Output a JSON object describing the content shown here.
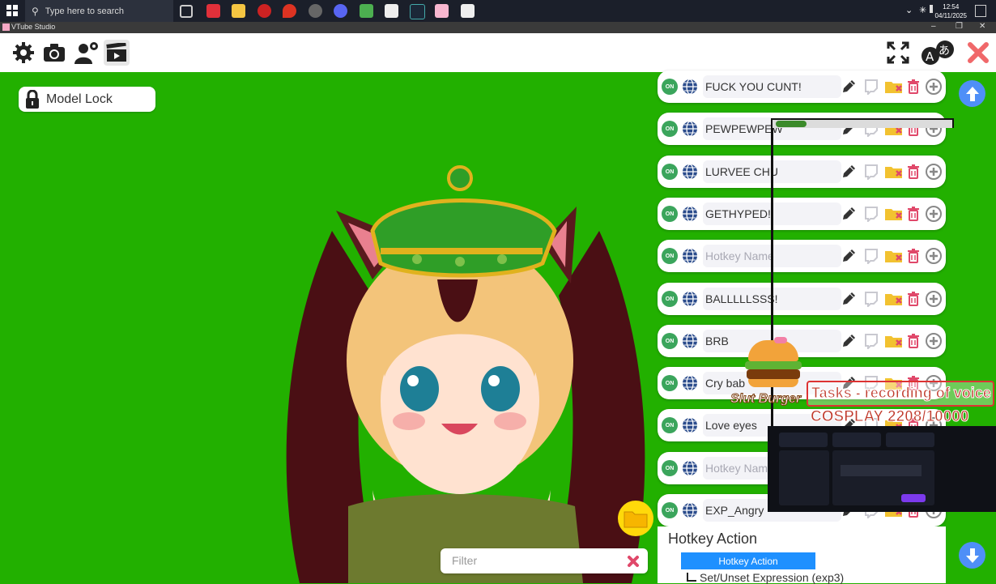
{
  "taskbar": {
    "search_placeholder": "Type here to search",
    "time": "12:54",
    "date": "04/11/2025"
  },
  "window": {
    "title": "VTube Studio"
  },
  "model_lock": {
    "label": "Model Lock"
  },
  "hotkeys": [
    {
      "status": "ON",
      "name": "FUCK YOU CUNT!",
      "placeholder": false
    },
    {
      "status": "ON",
      "name": "PEWPEWPEW",
      "placeholder": false
    },
    {
      "status": "ON",
      "name": "LURVEE CHU",
      "placeholder": false
    },
    {
      "status": "ON",
      "name": "GETHYPED!",
      "placeholder": false
    },
    {
      "status": "ON",
      "name": "Hotkey Name",
      "placeholder": true
    },
    {
      "status": "ON",
      "name": "BALLLLLSSS!",
      "placeholder": false
    },
    {
      "status": "ON",
      "name": "BRB",
      "placeholder": false
    },
    {
      "status": "ON",
      "name": "Cry bab",
      "placeholder": false
    },
    {
      "status": "ON",
      "name": "Love eyes",
      "placeholder": false
    },
    {
      "status": "ON",
      "name": "Hotkey Name",
      "placeholder": true
    },
    {
      "status": "ON",
      "name": "EXP_Angry",
      "placeholder": false
    }
  ],
  "hotkey_action": {
    "title": "Hotkey Action",
    "selected": "Hotkey Action",
    "sub_action": "Set/Unset Expression (exp3)"
  },
  "filter": {
    "placeholder": "Filter"
  },
  "overlay": {
    "burger_label": "Slut Burger",
    "banner_text": "Tasks - recording of voice",
    "cosplay_text": "COSPLAY 2208/10000"
  },
  "colors": {
    "background": "#22b000",
    "on_badge": "#3ba55c",
    "accent_blue": "#1e90ff",
    "delete_red": "#e0486a",
    "close_red": "#f0686a"
  }
}
